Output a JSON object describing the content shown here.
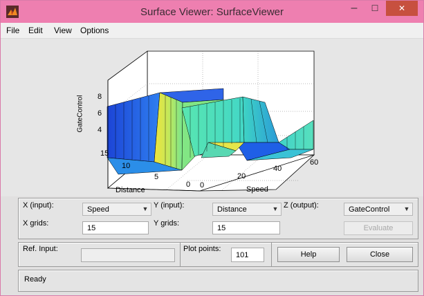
{
  "window": {
    "title": "Surface Viewer: SurfaceViewer",
    "min_label": "–",
    "max_label": "☐",
    "close_label": "✕"
  },
  "menu": [
    "File",
    "Edit",
    "View",
    "Options"
  ],
  "plot": {
    "zlabel": "GateControl",
    "ylabel": "Distance",
    "xlabel": "Speed",
    "z_ticks": [
      "8",
      "6",
      "4"
    ],
    "y_ticks": [
      "15",
      "10",
      "5",
      "0"
    ],
    "x_ticks": [
      "0",
      "20",
      "40",
      "60"
    ]
  },
  "controls": {
    "x_input_label": "X (input):",
    "x_input_value": "Speed",
    "y_input_label": "Y (input):",
    "y_input_value": "Distance",
    "z_output_label": "Z (output):",
    "z_output_value": "GateControl",
    "x_grids_label": "X grids:",
    "x_grids_value": "15",
    "y_grids_label": "Y grids:",
    "y_grids_value": "15",
    "evaluate_label": "Evaluate",
    "ref_input_label": "Ref. Input:",
    "ref_input_value": "",
    "plot_points_label": "Plot points:",
    "plot_points_value": "101",
    "help_label": "Help",
    "close_label": "Close"
  },
  "status": "Ready",
  "colors": {
    "titlebar": "#ee7fb0",
    "close": "#c7503f",
    "panel": "#e4e4e4"
  }
}
